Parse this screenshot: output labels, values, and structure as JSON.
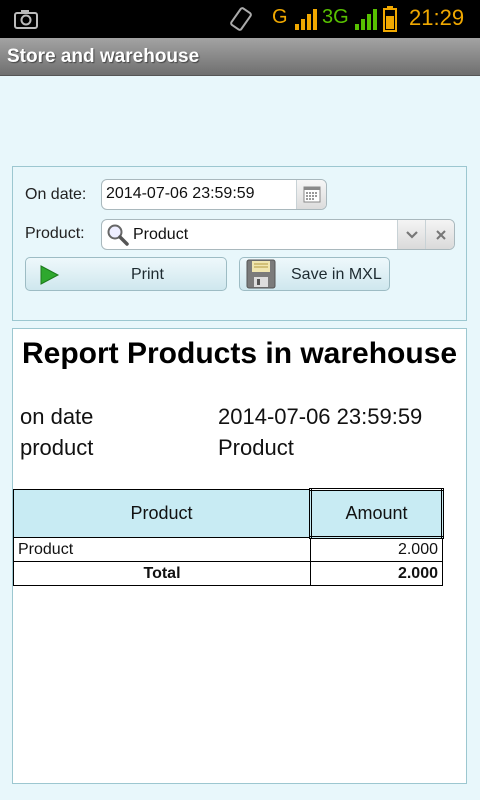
{
  "status_bar": {
    "network_1": "G",
    "network_2": "3G",
    "time": "21:29",
    "icons": [
      "camera-icon",
      "screen-rotation-icon",
      "signal-icon",
      "battery-icon"
    ]
  },
  "app": {
    "title": "Store and warehouse"
  },
  "form": {
    "date_label": "On date:",
    "date_value": "2014-07-06 23:59:59",
    "product_label": "Product:",
    "product_value": "Product",
    "print_label": "Print",
    "save_label": "Save in MXL"
  },
  "report": {
    "title": "Report Products in warehouse",
    "params": [
      {
        "name": "on date",
        "value": "2014-07-06 23:59:59"
      },
      {
        "name": "product",
        "value": "Product"
      }
    ],
    "table": {
      "headers": [
        "Product",
        "Amount"
      ],
      "rows": [
        {
          "product": "Product",
          "amount": "2.000"
        }
      ],
      "total": {
        "label": "Total",
        "amount": "2.000"
      }
    }
  },
  "colors": {
    "background": "#e8f7fb",
    "header_cell": "#c8ebf3",
    "status_accent": "#f0a800",
    "network_3g": "#58c000"
  }
}
